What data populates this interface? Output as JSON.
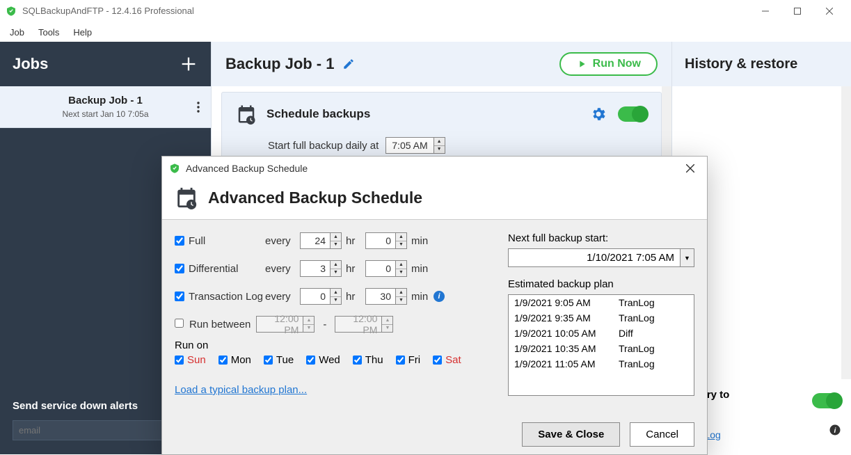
{
  "window": {
    "title": "SQLBackupAndFTP - 12.4.16 Professional"
  },
  "menu": {
    "job": "Job",
    "tools": "Tools",
    "help": "Help"
  },
  "sidebar": {
    "title": "Jobs",
    "job": {
      "name": "Backup Job - 1",
      "next": "Next start Jan 10 7:05a"
    },
    "alerts_label": "Send service down alerts",
    "email_placeholder": "email"
  },
  "content": {
    "title": "Backup Job - 1",
    "run_label": "Run Now",
    "schedule": {
      "title": "Schedule backups",
      "daily_label": "Start full backup daily at",
      "daily_time": "7:05 AM"
    }
  },
  "history": {
    "title": "History & restore",
    "footer_line1": "history to",
    "footer_line2": "Log",
    "link": "Web Log"
  },
  "dialog": {
    "title": "Advanced Backup Schedule",
    "header": "Advanced Backup Schedule",
    "full_label": "Full",
    "diff_label": "Differential",
    "tlog_label": "Transaction Log",
    "every": "every",
    "hr": "hr",
    "min": "min",
    "full_hr": "24",
    "full_min": "0",
    "diff_hr": "3",
    "diff_min": "0",
    "tlog_hr": "0",
    "tlog_min": "30",
    "runbetween_label": "Run between",
    "rb_from": "12:00 PM",
    "rb_to": "12:00 PM",
    "runon_label": "Run on",
    "days": {
      "sun": "Sun",
      "mon": "Mon",
      "tue": "Tue",
      "wed": "Wed",
      "thu": "Thu",
      "fri": "Fri",
      "sat": "Sat"
    },
    "load_link": "Load a typical backup plan...",
    "next_label": "Next full backup start:",
    "next_value": "1/10/2021 7:05 AM",
    "plan_label": "Estimated backup plan",
    "plan": [
      {
        "dt": "1/9/2021 9:05 AM",
        "type": "TranLog"
      },
      {
        "dt": "1/9/2021 9:35 AM",
        "type": "TranLog"
      },
      {
        "dt": "1/9/2021 10:05 AM",
        "type": "Diff"
      },
      {
        "dt": "1/9/2021 10:35 AM",
        "type": "TranLog"
      },
      {
        "dt": "1/9/2021 11:05 AM",
        "type": "TranLog"
      }
    ],
    "save": "Save & Close",
    "cancel": "Cancel"
  }
}
